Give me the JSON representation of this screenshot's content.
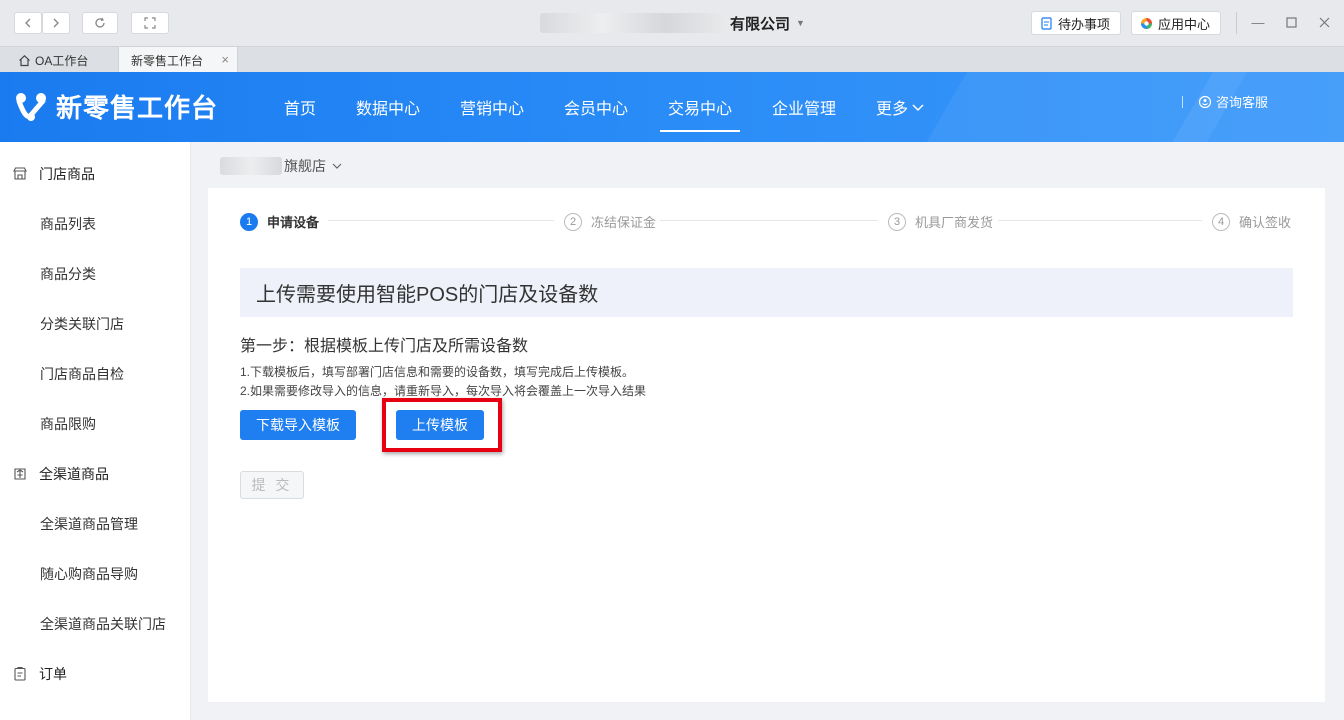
{
  "titlebar": {
    "company_suffix": "有限公司",
    "todo_label": "待办事项",
    "apps_label": "应用中心"
  },
  "tabs": [
    {
      "label": "OA工作台",
      "icon": "home-icon"
    },
    {
      "label": "新零售工作台",
      "active": true
    }
  ],
  "header": {
    "app_name": "新零售工作台",
    "nav": [
      "首页",
      "数据中心",
      "营销中心",
      "会员中心",
      "交易中心",
      "企业管理",
      "更多"
    ],
    "active_nav": "交易中心",
    "service_label": "咨询客服"
  },
  "sidebar": {
    "groups": [
      {
        "label": "门店商品",
        "icon": "store-goods-icon",
        "items": [
          "商品列表",
          "商品分类",
          "分类关联门店",
          "门店商品自检",
          "商品限购"
        ]
      },
      {
        "label": "全渠道商品",
        "icon": "omni-channel-icon",
        "items": [
          "全渠道商品管理",
          "随心购商品导购",
          "全渠道商品关联门店"
        ]
      },
      {
        "label": "订单",
        "icon": "order-icon",
        "items": []
      }
    ]
  },
  "store": {
    "name_suffix": "旗舰店"
  },
  "steps": [
    {
      "num": "1",
      "label": "申请设备",
      "active": true
    },
    {
      "num": "2",
      "label": "冻结保证金"
    },
    {
      "num": "3",
      "label": "机具厂商发货"
    },
    {
      "num": "4",
      "label": "确认签收"
    }
  ],
  "content": {
    "banner": "上传需要使用智能POS的门店及设备数",
    "step_title": "第一步：根据模板上传门店及所需设备数",
    "desc1": "1.下载模板后，填写部署门店信息和需要的设备数，填写完成后上传模板。",
    "desc2": "2.如果需要修改导入的信息，请重新导入，每次导入将会覆盖上一次导入结果",
    "download_btn": "下载导入模板",
    "upload_btn": "上传模板",
    "submit_btn": "提 交"
  },
  "colors": {
    "primary": "#1f7ef0",
    "highlight": "#e60012"
  }
}
